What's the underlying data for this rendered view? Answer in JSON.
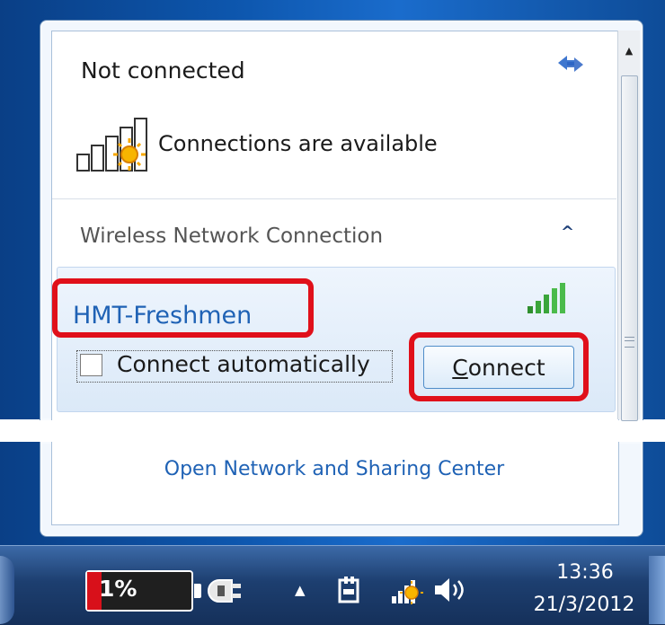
{
  "status": {
    "title": "Not connected",
    "availability": "Connections are available"
  },
  "section": {
    "title": "Wireless Network Connection"
  },
  "network": {
    "ssid": "HMT-Freshmen",
    "auto_label": "Connect automatically",
    "auto_checked": false,
    "connect_label_first": "C",
    "connect_label_rest": "onnect"
  },
  "footer": {
    "link": "Open Network and Sharing Center"
  },
  "taskbar": {
    "battery_percent": "1%",
    "time": "13:36",
    "date": "21/3/2012"
  },
  "colors": {
    "highlight": "#e0101a",
    "link": "#1f62b5",
    "desktop": "#0d56ad"
  },
  "icons": [
    "refresh-icon",
    "signal-bars-icon",
    "collapse-icon",
    "scroll-up-icon",
    "battery-icon",
    "power-plug-icon",
    "show-hidden-icon",
    "network-tray-icon",
    "volume-icon"
  ]
}
